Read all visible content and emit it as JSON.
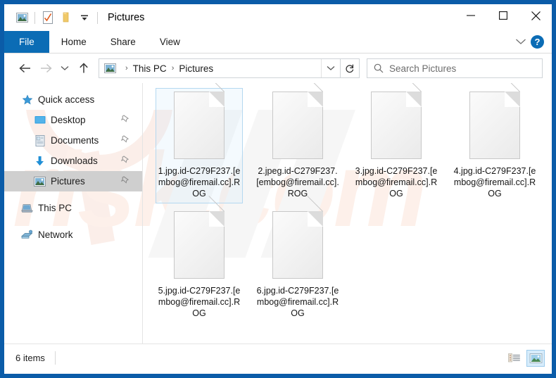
{
  "window": {
    "title": "Pictures",
    "minimize_label": "—",
    "maximize_label": "□",
    "close_label": "✕"
  },
  "quick_access_toolbar": {
    "items": [
      {
        "name": "explorer-picture-icon",
        "label": ""
      },
      {
        "name": "properties-icon",
        "label": ""
      },
      {
        "name": "new-folder-icon",
        "label": ""
      },
      {
        "name": "customize-dropdown-icon",
        "label": "▾"
      }
    ]
  },
  "ribbon": {
    "tabs": [
      {
        "label": "File",
        "active": true
      },
      {
        "label": "Home",
        "active": false
      },
      {
        "label": "Share",
        "active": false
      },
      {
        "label": "View",
        "active": false
      }
    ],
    "collapse_label": "⌵",
    "help_label": "?"
  },
  "address_bar": {
    "back_label": "←",
    "forward_label": "→",
    "recent_label": "⌵",
    "up_label": "↑",
    "breadcrumbs": [
      "This PC",
      "Pictures"
    ],
    "separator": "›",
    "dropdown_label": "⌵",
    "refresh_label": "↻"
  },
  "search": {
    "placeholder": "Search Pictures",
    "value": ""
  },
  "sidebar": {
    "groups": [
      {
        "header": {
          "label": "Quick access",
          "icon": "star-icon"
        },
        "items": [
          {
            "label": "Desktop",
            "icon": "desktop-icon",
            "pinned": true,
            "selected": false
          },
          {
            "label": "Documents",
            "icon": "documents-icon",
            "pinned": true,
            "selected": false
          },
          {
            "label": "Downloads",
            "icon": "downloads-icon",
            "pinned": true,
            "selected": false
          },
          {
            "label": "Pictures",
            "icon": "pictures-icon",
            "pinned": true,
            "selected": true
          }
        ]
      },
      {
        "header": {
          "label": "This PC",
          "icon": "this-pc-icon"
        },
        "items": []
      },
      {
        "header": {
          "label": "Network",
          "icon": "network-icon"
        },
        "items": []
      }
    ],
    "pin_glyph": "📌"
  },
  "files": [
    {
      "name": "1.jpg.id-C279F237.[embog@firemail.cc].ROG",
      "selected": true
    },
    {
      "name": "2.jpeg.id-C279F237.[embog@firemail.cc].ROG",
      "selected": false
    },
    {
      "name": "3.jpg.id-C279F237.[embog@firemail.cc].ROG",
      "selected": false
    },
    {
      "name": "4.jpg.id-C279F237.[embog@firemail.cc].ROG",
      "selected": false
    },
    {
      "name": "5.jpg.id-C279F237.[embog@firemail.cc].ROG",
      "selected": false
    },
    {
      "name": "6.jpg.id-C279F237.[embog@firemail.cc].ROG",
      "selected": false
    }
  ],
  "status_bar": {
    "item_count": "6 items",
    "details_view_label": "",
    "large_icons_view_label": ""
  },
  "watermark": {
    "text": "risk.com"
  },
  "colors": {
    "window_border": "#0b5ca8",
    "file_tab": "#0b6cb5",
    "selection_border": "#b4d8f0",
    "sidebar_selected": "#cfcfcf",
    "view_active": "#d7ecfb"
  }
}
